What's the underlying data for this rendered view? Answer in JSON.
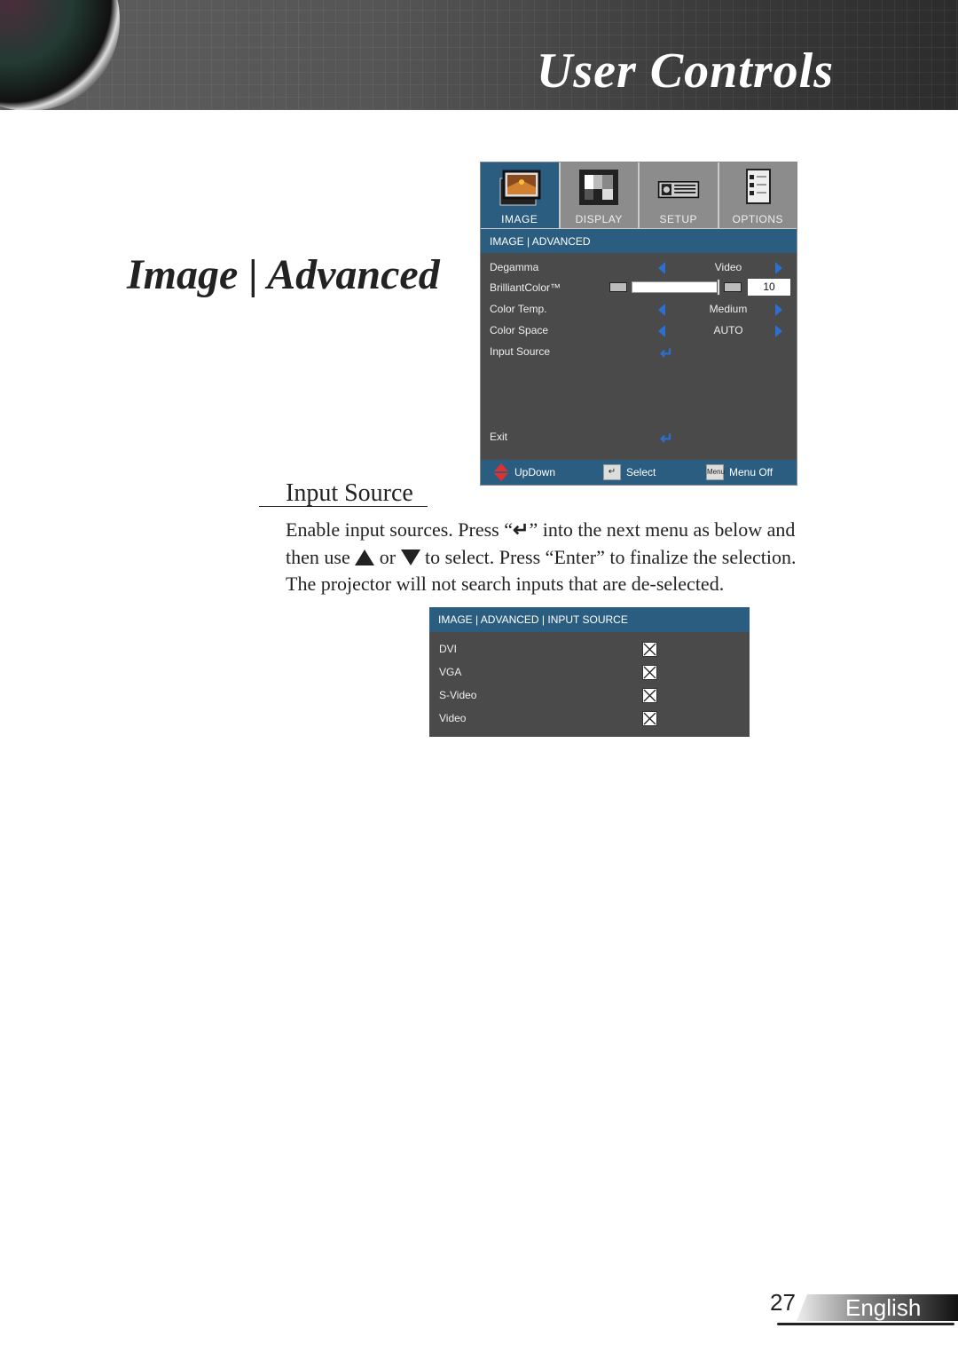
{
  "header": {
    "title": "User Controls"
  },
  "page_title": "Image | Advanced",
  "osd_menu": {
    "tabs": [
      {
        "label": "IMAGE",
        "icon": "image-icon",
        "active": true
      },
      {
        "label": "DISPLAY",
        "icon": "display-icon",
        "active": false
      },
      {
        "label": "SETUP",
        "icon": "projector-icon",
        "active": false
      },
      {
        "label": "OPTIONS",
        "icon": "options-checklist-icon",
        "active": false
      }
    ],
    "breadcrumb": "IMAGE | ADVANCED",
    "rows": [
      {
        "label": "Degamma",
        "value": "Video"
      },
      {
        "label": "BrilliantColor™",
        "value": "10",
        "slider_percent": 100
      },
      {
        "label": "Color Temp.",
        "value": "Medium"
      },
      {
        "label": "Color Space",
        "value": "AUTO"
      },
      {
        "label": "Input Source"
      }
    ],
    "exit": "Exit",
    "footer": {
      "updown": "UpDown",
      "select": "Select",
      "menu_key": "Menu",
      "menu_off": "Menu Off"
    },
    "colors": {
      "accent": "#2b5d80",
      "arrow": "#2d6fd0",
      "background": "#4a4a4a"
    }
  },
  "section": {
    "heading": "Input Source",
    "p1a": "Enable input sources. Press “",
    "p1b": "” into the next menu as below and",
    "p2a": "then use ",
    "p2b": " or ",
    "p2c": " to select. Press “Enter” to finalize the selection.",
    "p3": "The projector will not search inputs that are de-selected."
  },
  "input_menu": {
    "breadcrumb": "IMAGE | ADVANCED | INPUT SOURCE",
    "sources": [
      {
        "label": "DVI",
        "checked": true
      },
      {
        "label": "VGA",
        "checked": true
      },
      {
        "label": "S-Video",
        "checked": true
      },
      {
        "label": "Video",
        "checked": true
      }
    ]
  },
  "footer": {
    "page_number": "27",
    "language": "English"
  }
}
